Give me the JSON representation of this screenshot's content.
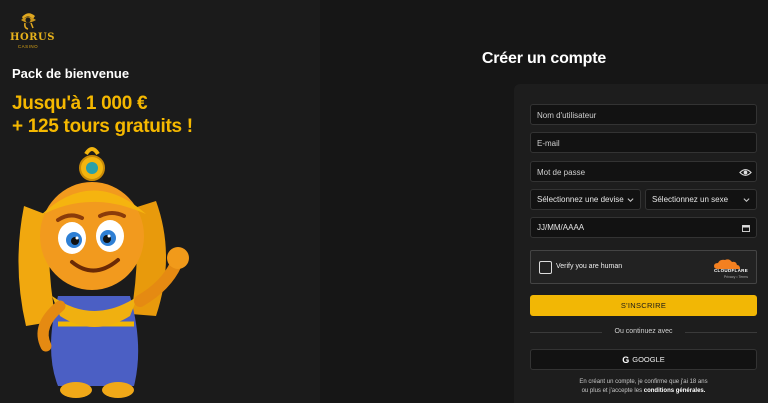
{
  "brand": {
    "name": "HORUS",
    "sub": "CASINO"
  },
  "promo": {
    "welcome": "Pack de bienvenue",
    "line1": "Jusqu'à 1 000 €",
    "line2": "+ 125 tours gratuits !"
  },
  "form": {
    "title": "Créer un compte",
    "username_placeholder": "Nom d'utilisateur",
    "email_placeholder": "E-mail",
    "password_placeholder": "Mot de passe",
    "currency_select": "Sélectionnez une devise",
    "gender_select": "Sélectionnez un sexe",
    "birthdate": "JJ/MM/AAAA",
    "captcha_label": "Verify you are human",
    "captcha_brand": "CLOUDFLARE",
    "captcha_links": "Privacy • Terms",
    "signup_label": "S'INSCRIRE",
    "or_text": "Ou continuez avec",
    "google_label": "GOOGLE",
    "legal_line1": "En créant un compte, je confirme que j'ai 18 ans",
    "legal_line2_prefix": "ou plus et j'accepte les",
    "legal_link": "conditions générales."
  },
  "colors": {
    "accent": "#f2b705",
    "panel": "#1d1d1d",
    "left_bg": "#1b1b1b"
  }
}
